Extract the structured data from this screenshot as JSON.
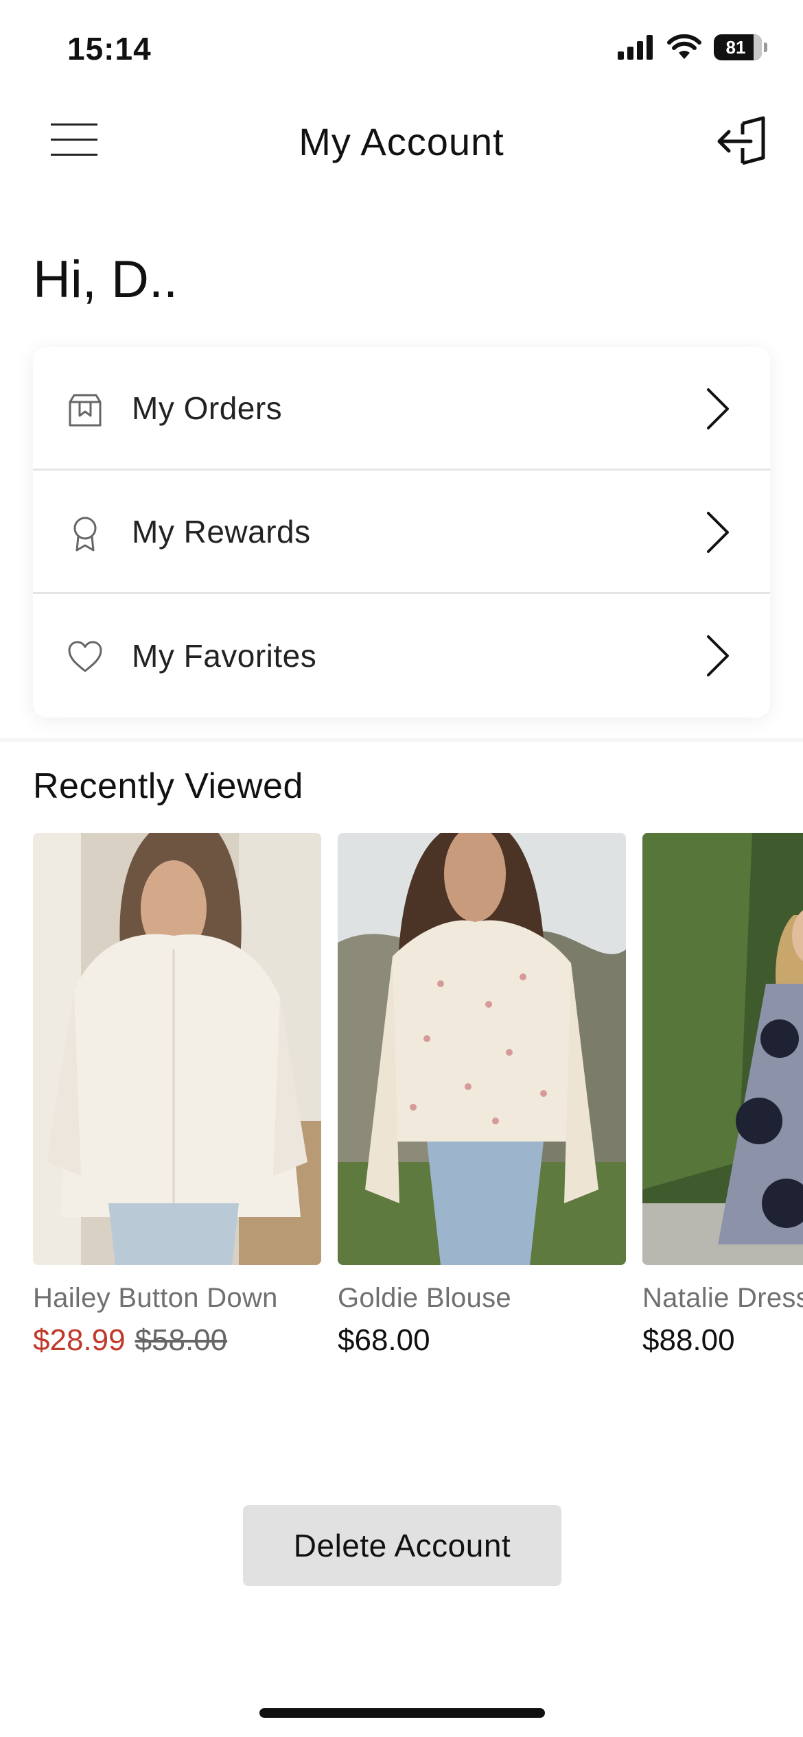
{
  "status_bar": {
    "time": "15:14",
    "battery": "81"
  },
  "header": {
    "title": "My Account"
  },
  "greeting": "Hi,  D..",
  "menu": [
    {
      "label": "My Orders",
      "icon": "orders-box-icon"
    },
    {
      "label": "My Rewards",
      "icon": "award-ribbon-icon"
    },
    {
      "label": "My Favorites",
      "icon": "heart-icon"
    }
  ],
  "recently_viewed": {
    "title": "Recently Viewed",
    "products": [
      {
        "name": "Hailey Button Down",
        "sale_price": "$28.99",
        "original_price": "$58.00"
      },
      {
        "name": "Goldie Blouse",
        "price": "$68.00"
      },
      {
        "name": "Natalie Dress",
        "price": "$88.00"
      }
    ]
  },
  "delete_account_label": "Delete Account",
  "colors": {
    "sale": "#c0392b",
    "delete_button_bg": "#e1e1e1"
  }
}
